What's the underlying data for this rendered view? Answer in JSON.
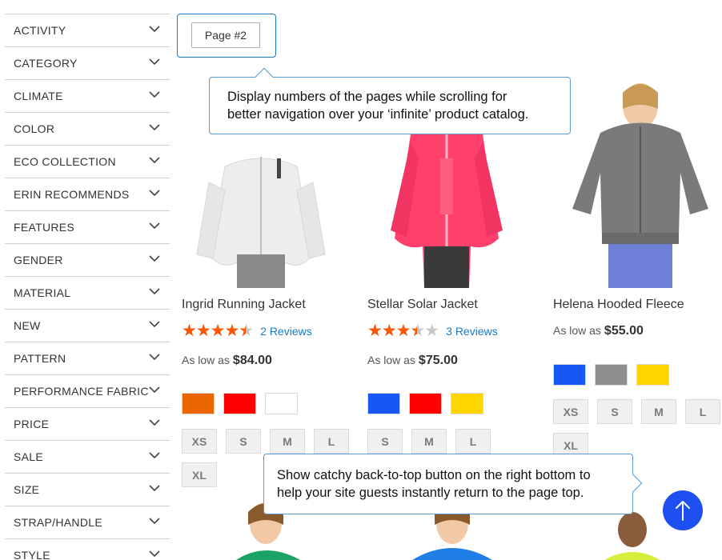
{
  "sidebar": {
    "filters": [
      "ACTIVITY",
      "CATEGORY",
      "CLIMATE",
      "COLOR",
      "ECO COLLECTION",
      "ERIN RECOMMENDS",
      "FEATURES",
      "GENDER",
      "MATERIAL",
      "NEW",
      "PATTERN",
      "PERFORMANCE FABRIC",
      "PRICE",
      "SALE",
      "SIZE",
      "STRAP/HANDLE",
      "STYLE"
    ]
  },
  "page_marker": {
    "label": "Page #2"
  },
  "tooltips": {
    "pages": [
      "Display numbers of the pages while scrolling for",
      "better navigation over your ‘infinite’ product catalog."
    ],
    "back_to_top": [
      "Show catchy back-to-top button on the right bottom to",
      "help your site guests instantly return to the page top."
    ]
  },
  "products": [
    {
      "name": "Ingrid Running Jacket",
      "rating": 4.5,
      "reviews": "2 Reviews",
      "price_prefix": "As low as",
      "price": "$84.00",
      "colors": [
        "#eb6703",
        "#ff0000",
        "#ffffff"
      ],
      "sizes": [
        "XS",
        "S",
        "M",
        "L",
        "XL"
      ],
      "jacket_color": "#f2f2f2"
    },
    {
      "name": "Stellar Solar Jacket",
      "rating": 3.5,
      "reviews": "3 Reviews",
      "price_prefix": "As low as",
      "price": "$75.00",
      "colors": [
        "#1857f7",
        "#ff0000",
        "#ffd500"
      ],
      "sizes": [
        "S",
        "M",
        "L"
      ],
      "jacket_color": "#ff3f6c"
    },
    {
      "name": "Helena Hooded Fleece",
      "rating": null,
      "reviews": "",
      "price_prefix": "As low as",
      "price": "$55.00",
      "colors": [
        "#1857f7",
        "#8f8f8f",
        "#ffd500"
      ],
      "sizes": [
        "XS",
        "S",
        "M",
        "L",
        "XL"
      ],
      "jacket_color": "#7a7a7a"
    }
  ],
  "colors": {
    "accent": "#1979c3",
    "star": "#ff5501",
    "back_to_top": "#1e4ff0"
  },
  "icons": {
    "filter_toggle": "chevron-down-icon",
    "back_to_top": "arrow-up-icon",
    "rating": "star-icon"
  }
}
